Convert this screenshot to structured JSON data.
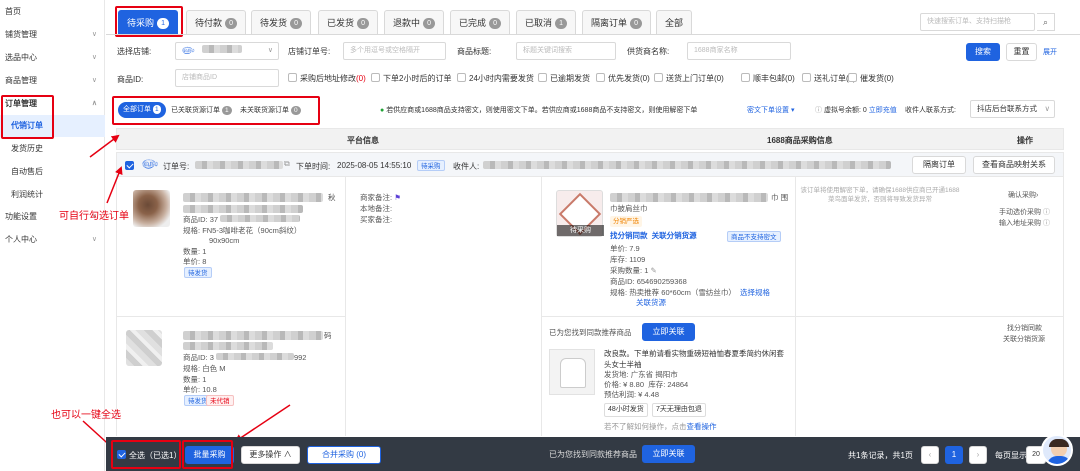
{
  "sidebar": {
    "items": [
      {
        "label": "首页"
      },
      {
        "label": "铺货管理"
      },
      {
        "label": "选品中心"
      },
      {
        "label": "商品管理"
      },
      {
        "label": "订单管理"
      },
      {
        "label": "代销订单"
      },
      {
        "label": "发货历史"
      },
      {
        "label": "自动售后"
      },
      {
        "label": "利润统计"
      },
      {
        "label": "功能设置"
      },
      {
        "label": "个人中心"
      }
    ]
  },
  "tabs": [
    {
      "label": "待采购",
      "count": "1"
    },
    {
      "label": "待付款",
      "count": "0"
    },
    {
      "label": "待发货",
      "count": "0"
    },
    {
      "label": "已发货",
      "count": "0"
    },
    {
      "label": "退款中",
      "count": "0"
    },
    {
      "label": "已完成",
      "count": "0"
    },
    {
      "label": "已取消",
      "count": "1"
    },
    {
      "label": "隔离订单",
      "count": "0"
    },
    {
      "label": "全部",
      "count": ""
    }
  ],
  "top_search": {
    "placeholder": "快速搜索订单、支持扫描枪"
  },
  "filters": {
    "store_label": "选择店铺:",
    "store_order_label": "店铺订单号:",
    "store_order_placeholder": "多个用逗号或空格隔开",
    "title_label": "商品标题:",
    "title_placeholder": "标题关键词搜索",
    "supplier_label": "供货商名称:",
    "supplier_placeholder": "1688商家名称",
    "search_btn": "搜索",
    "reset_btn": "重置",
    "expand": "展开",
    "pid_label": "商品ID:",
    "pid_placeholder": "店铺商品ID",
    "checks": [
      {
        "label": "采购后地址修改",
        "count": "(0)",
        "count_red": true
      },
      {
        "label": "下单2小时后的订单",
        "count": "",
        "count_red": false
      },
      {
        "label": "24小时内需要发货",
        "count": "",
        "count_red": false
      },
      {
        "label": "已逾期发货",
        "count": "",
        "count_red": false
      },
      {
        "label": "优先发货",
        "count": "(0)",
        "count_red": false
      },
      {
        "label": "送货上门订单",
        "count": "(0)",
        "count_red": false
      },
      {
        "label": "顺丰包邮",
        "count": "(0)",
        "count_red": false
      },
      {
        "label": "送礼订单",
        "count": "(0)",
        "count_red": false
      },
      {
        "label": "催发货",
        "count": "(0)",
        "count_red": false
      }
    ]
  },
  "subtabs": [
    {
      "label": "全部订单",
      "count": "1"
    },
    {
      "label": "已关联货源订单",
      "count": "1"
    },
    {
      "label": "未关联货源订单",
      "count": "0"
    }
  ],
  "notice": {
    "text": "若供应商或1688商品支持密文，则使用密文下单。若供应商或1688商品不支持密文，则使用解密下单",
    "setting_link": "密文下单设置 ▾",
    "balance_label": "虚拟号余额:",
    "balance_value": "0",
    "recharge": "立即充值",
    "contact_label": "收件人联系方式:",
    "contact_value": "抖店后台联系方式"
  },
  "table_header": {
    "col1": "平台信息",
    "col2": "1688商品采购信息",
    "col3": "操作"
  },
  "order": {
    "order_no_label": "订单号:",
    "time_label": "下单时间:",
    "time_value": "2025-08-05 14:55:10",
    "status_tag": "待采购",
    "receiver_label": "收件人:",
    "isolate_btn": "隔离订单",
    "mapping_btn": "查看商品映射关系"
  },
  "item1": {
    "title_tail": "秋",
    "pid_label": "商品ID:",
    "pid_prefix": "37",
    "spec_label": "规格:",
    "spec_value": "FN5-3咖啡老花（90cm斜纹）",
    "spec_value2": "90x90cm",
    "qty_label": "数量:",
    "qty_value": "1",
    "price_label": "单价:",
    "price_value": "8",
    "status": "待发货",
    "remarks": [
      "商家备注:",
      "本地备注:",
      "买家备注:"
    ],
    "src_title_tail": "巾 围",
    "src_title2": "巾披肩丝巾",
    "src_tag": "分销严选",
    "img_badge": "待采购",
    "find_link": "找分销同款",
    "relate_link": "关联分销货源",
    "cipher_tag": "商品不支持密文",
    "src_price_label": "单价:",
    "src_price": "7.9",
    "stock_label": "库存:",
    "stock": "1109",
    "buy_qty_label": "采购数量:",
    "buy_qty": "1",
    "src_pid_label": "商品ID:",
    "src_pid": "654690259368",
    "src_spec_label": "规格:",
    "src_spec": "热卖推荐 60*60cm（雪纺丝巾）",
    "choose_spec": "选择规格",
    "relate_source": "关联货源",
    "col3_note": "该订单将使用解密下单，请确保1688供应商已开通1688菜鸟面单发货，否则将导致发货异常",
    "actions": [
      "确认采购›",
      "手动选价采购",
      "输入地址采购"
    ]
  },
  "item2": {
    "title_tail": "码",
    "pid_label": "商品ID:",
    "pid_prefix": "3",
    "pid_suffix": "992",
    "spec_label": "规格:",
    "spec_value": "白色 M",
    "qty_label": "数量:",
    "qty_value": "1",
    "price_label": "单价:",
    "price_value": "10.8",
    "status1": "待发货",
    "status2": "未代销",
    "found_text": "已为您找到同款推荐商品",
    "relate_now": "立即关联",
    "rec_title": "改良款。下单前请看实物重磅短袖恤春夏季简约休闲套头女士半袖",
    "ship_label": "发货地:",
    "ship_value": "广东省 揭阳市",
    "price_row": "价格: ¥ 8.80",
    "stock_row": "库存: 24864",
    "profit_row": "预估利润: ¥ 4.48",
    "tags": [
      "48小时发货",
      "7天无理由包退"
    ],
    "help_text": "若不了解如何操作，点击",
    "help_link": "查看操作",
    "actions": [
      "找分销同款",
      "关联分销货源"
    ]
  },
  "bottom_bar": {
    "select_all": "全选（已选1）",
    "batch_buy": "批量采购",
    "more": "更多操作 ∧",
    "merge": "合并采购 (0)",
    "found_text": "已为您找到同款推荐商品",
    "relate_now": "立即关联",
    "records": "共1条记录，共1页",
    "page": "1",
    "per_page": "每页显示",
    "per_page_value": "20"
  },
  "annotations": {
    "a1": "可自行勾选订单",
    "a2": "也可以一键全选"
  },
  "colors": {
    "accent": "#1f63e0",
    "annotation": "#e60012"
  }
}
